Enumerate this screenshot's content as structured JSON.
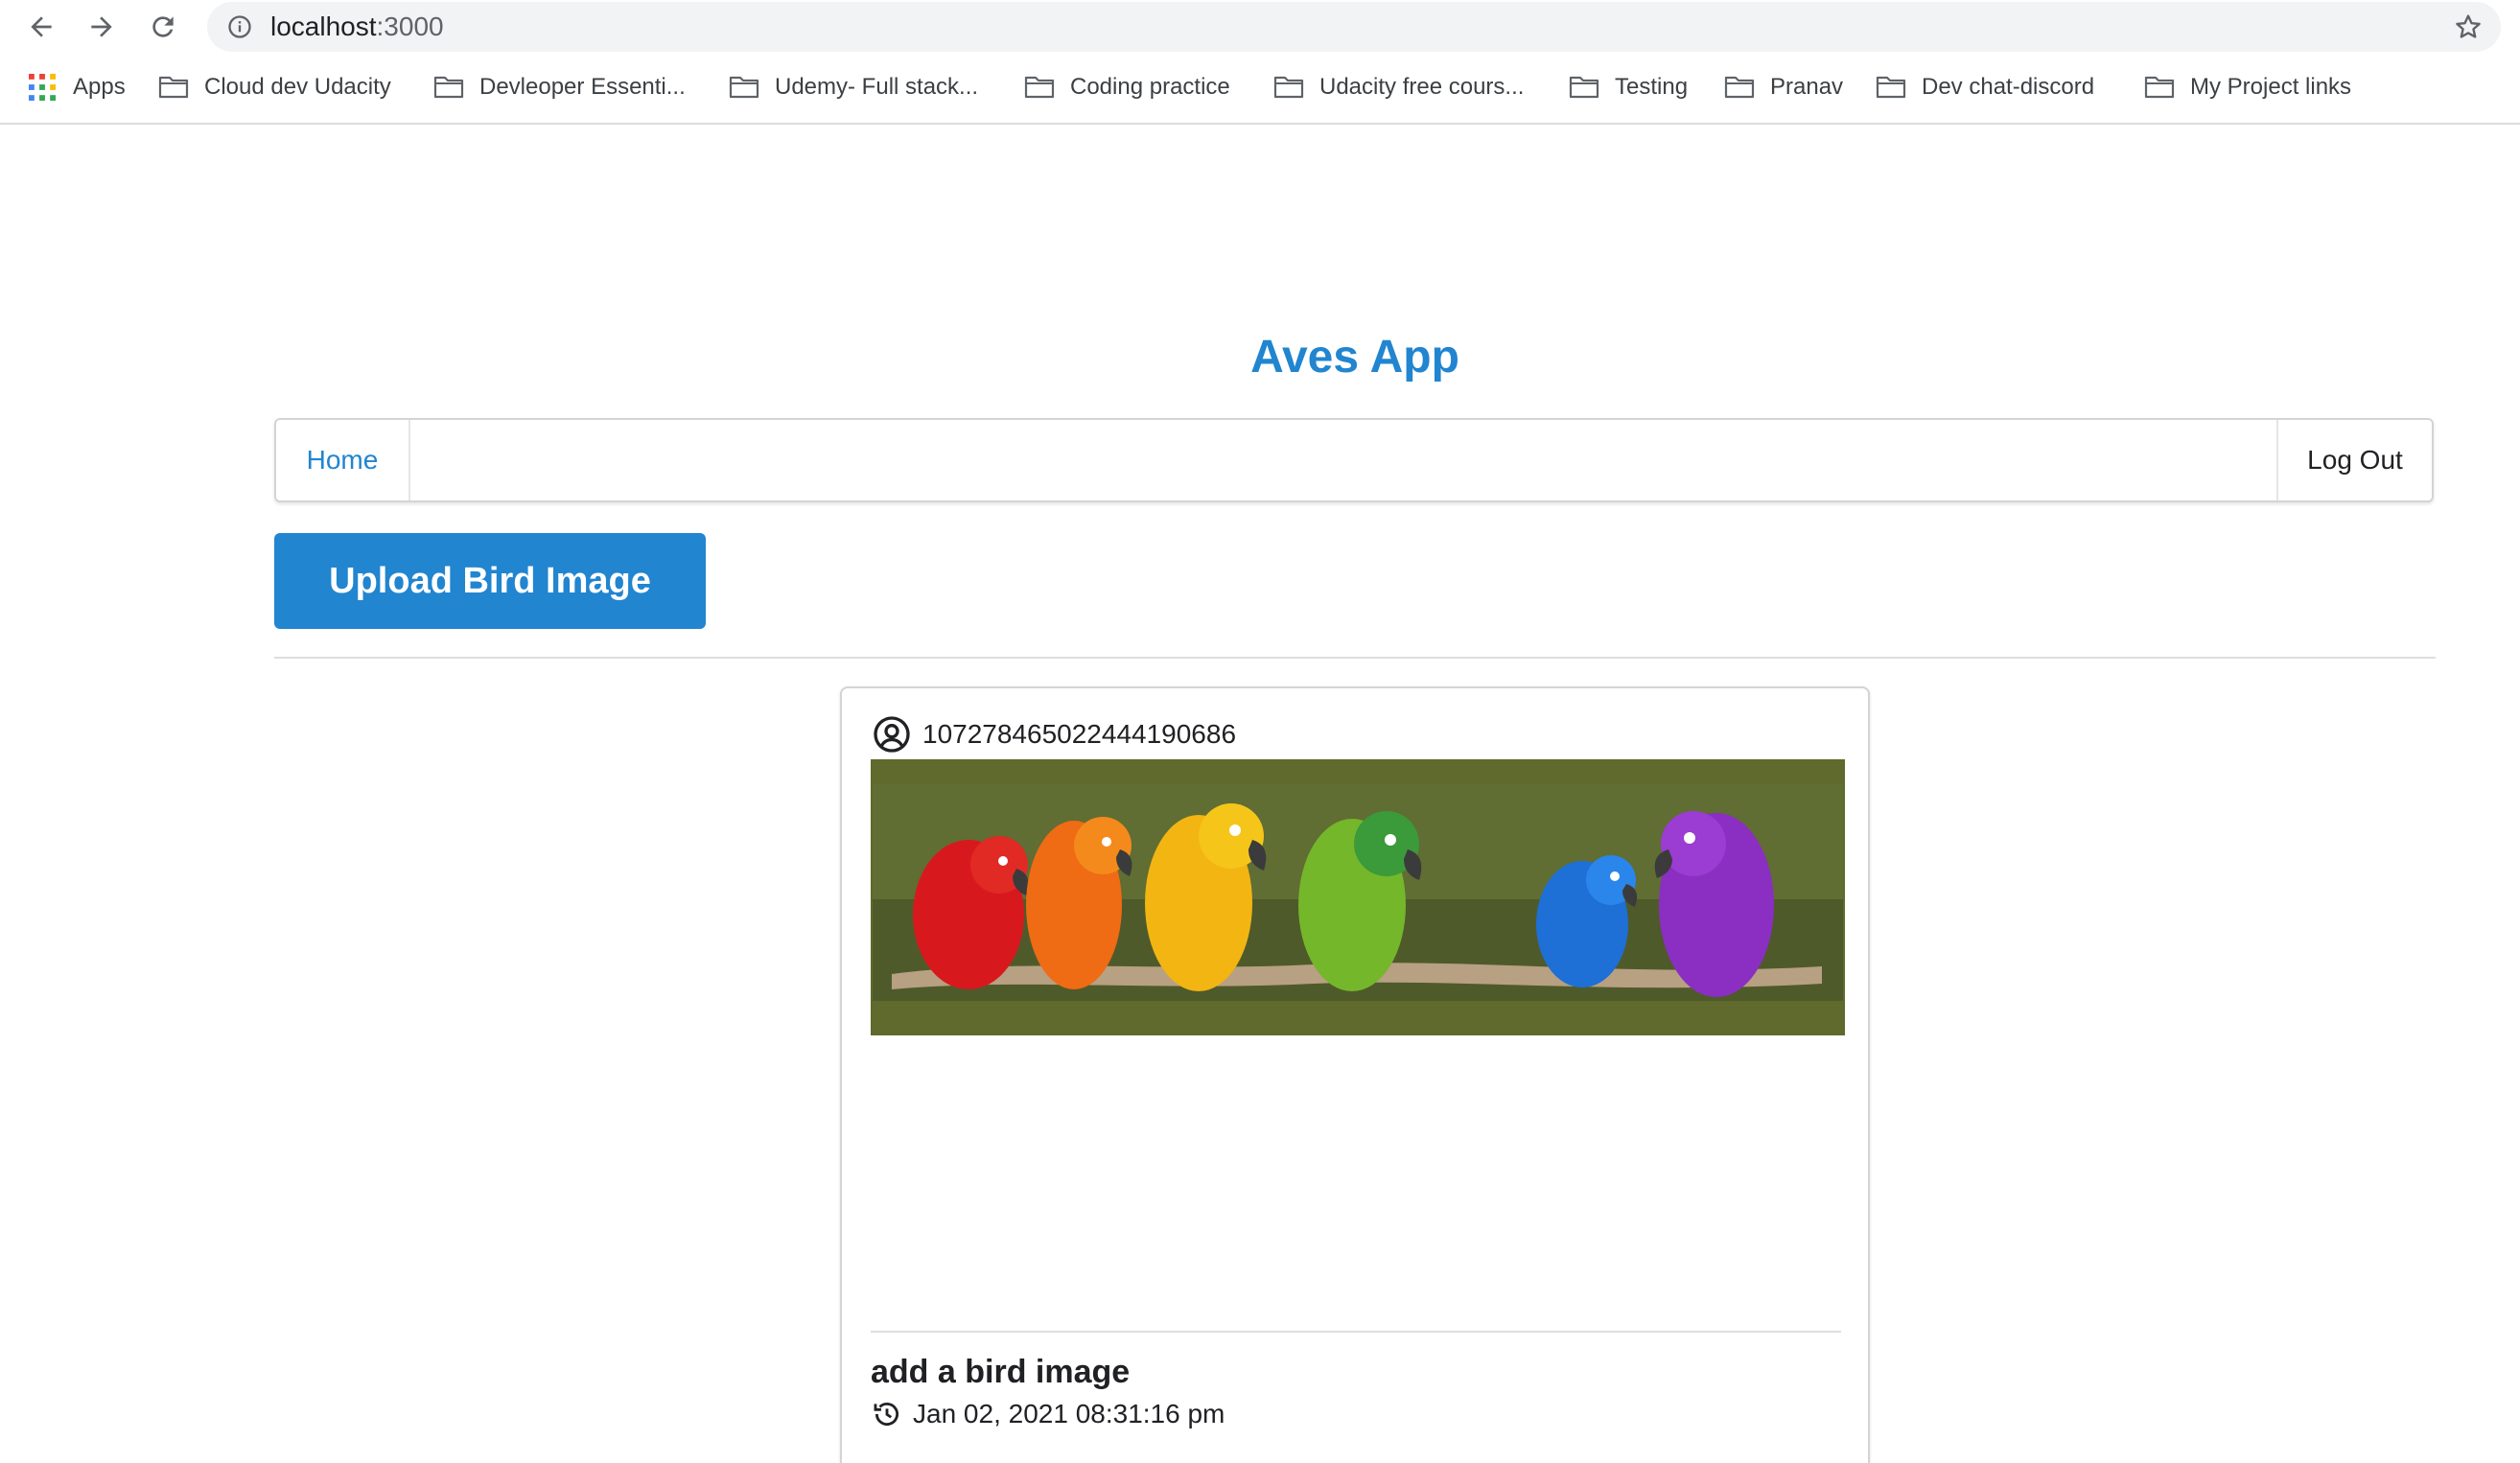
{
  "browser": {
    "url_host": "localhost",
    "url_port": ":3000",
    "bookmarks": [
      {
        "label": "Apps",
        "icon": "apps-grid-icon"
      },
      {
        "label": "Cloud dev Udacity",
        "icon": "folder-icon"
      },
      {
        "label": "Devleoper Essenti...",
        "icon": "folder-icon"
      },
      {
        "label": "Udemy- Full stack...",
        "icon": "folder-icon"
      },
      {
        "label": "Coding practice",
        "icon": "folder-icon"
      },
      {
        "label": "Udacity free cours...",
        "icon": "folder-icon"
      },
      {
        "label": "Testing",
        "icon": "folder-icon"
      },
      {
        "label": "Pranav",
        "icon": "folder-icon"
      },
      {
        "label": "Dev chat-discord",
        "icon": "folder-icon"
      },
      {
        "label": "My Project links",
        "icon": "folder-icon"
      }
    ]
  },
  "app": {
    "title": "Aves App",
    "accent_color": "#2185d0"
  },
  "menu": {
    "home_label": "Home",
    "logout_label": "Log Out"
  },
  "upload_button": {
    "label": "Upload Bird Image"
  },
  "post": {
    "user_id": "107278465022444190686",
    "user_icon": "user-circle-icon",
    "title": "add a bird image",
    "date_icon": "history-icon",
    "date": "Jan 02, 2021 08:31:16 pm"
  }
}
